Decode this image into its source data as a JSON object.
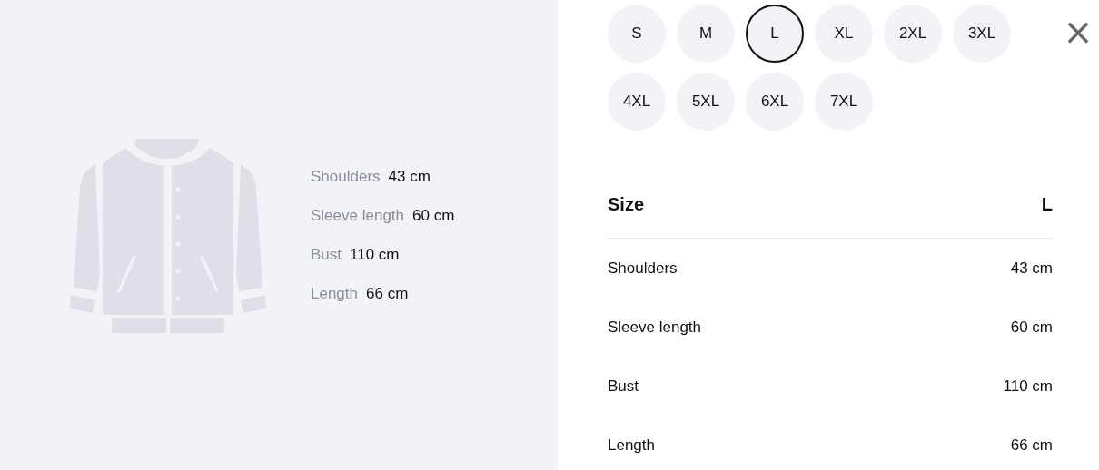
{
  "measurements_preview": [
    {
      "label": "Shoulders",
      "value": "43 cm"
    },
    {
      "label": "Sleeve length",
      "value": "60 cm"
    },
    {
      "label": "Bust",
      "value": "110 cm"
    },
    {
      "label": "Length",
      "value": "66 cm"
    }
  ],
  "sizes": [
    {
      "label": "S",
      "selected": false
    },
    {
      "label": "M",
      "selected": false
    },
    {
      "label": "L",
      "selected": true
    },
    {
      "label": "XL",
      "selected": false
    },
    {
      "label": "2XL",
      "selected": false
    },
    {
      "label": "3XL",
      "selected": false
    },
    {
      "label": "4XL",
      "selected": false
    },
    {
      "label": "5XL",
      "selected": false
    },
    {
      "label": "6XL",
      "selected": false
    },
    {
      "label": "7XL",
      "selected": false
    }
  ],
  "close_button": "×",
  "size_table": {
    "header": {
      "label": "Size",
      "value": "L"
    },
    "rows": [
      {
        "label": "Shoulders",
        "value": "43 cm"
      },
      {
        "label": "Sleeve length",
        "value": "60 cm"
      },
      {
        "label": "Bust",
        "value": "110 cm"
      },
      {
        "label": "Length",
        "value": "66 cm"
      }
    ]
  }
}
